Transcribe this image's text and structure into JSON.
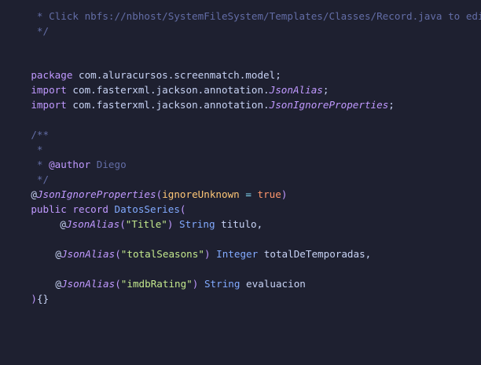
{
  "code": {
    "l1": {
      "text": " * Click nbfs://nbhost/SystemFileSystem/Templates/Classes/Record.java to edit"
    },
    "l2": {
      "text": " */"
    },
    "l5": {
      "kw": "package",
      "pkg": " com.aluracursos.screenmatch.model",
      "semi": ";"
    },
    "l6": {
      "kw": "import",
      "pkg": " com.fasterxml.jackson.annotation.",
      "cls": "JsonAlias",
      "semi": ";"
    },
    "l7": {
      "kw": "import",
      "pkg": " com.fasterxml.jackson.annotation.",
      "cls": "JsonIgnoreProperties",
      "semi": ";"
    },
    "l9": {
      "text": "/**"
    },
    "l10": {
      "text": " *"
    },
    "l11": {
      "prefix": " * ",
      "tag": "@author",
      "author": " Diego"
    },
    "l12": {
      "text": " */"
    },
    "l13": {
      "at": "@",
      "ann": "JsonIgnoreProperties",
      "open": "(",
      "param": "ignoreUnknown",
      "op": " = ",
      "bool": "true",
      "close": ")"
    },
    "l14": {
      "kw1": "public",
      "kw2": " record",
      "name": " DatosSeries",
      "open": "("
    },
    "l15": {
      "at": "@",
      "ann": "JsonAlias",
      "open": "(",
      "str": "\"Title\"",
      "close": ")",
      "type": " String",
      "var": " titulo,"
    },
    "l17": {
      "at": "@",
      "ann": "JsonAlias",
      "open": "(",
      "str": "\"totalSeasons\"",
      "close": ")",
      "type": " Integer",
      "var": " totalDeTemporadas,"
    },
    "l19": {
      "at": "@",
      "ann": "JsonAlias",
      "open": "(",
      "str": "\"imdbRating\"",
      "close": ")",
      "type": " String",
      "var": " evaluacion"
    },
    "l20": {
      "close": ")",
      "braces": "{}"
    }
  },
  "colors": {
    "background": "#1e2030",
    "comment": "#636da6",
    "keyword": "#c099ff",
    "string": "#c3e88d",
    "type": "#82aaff",
    "parameter": "#ffc777",
    "boolean": "#ff966c"
  }
}
